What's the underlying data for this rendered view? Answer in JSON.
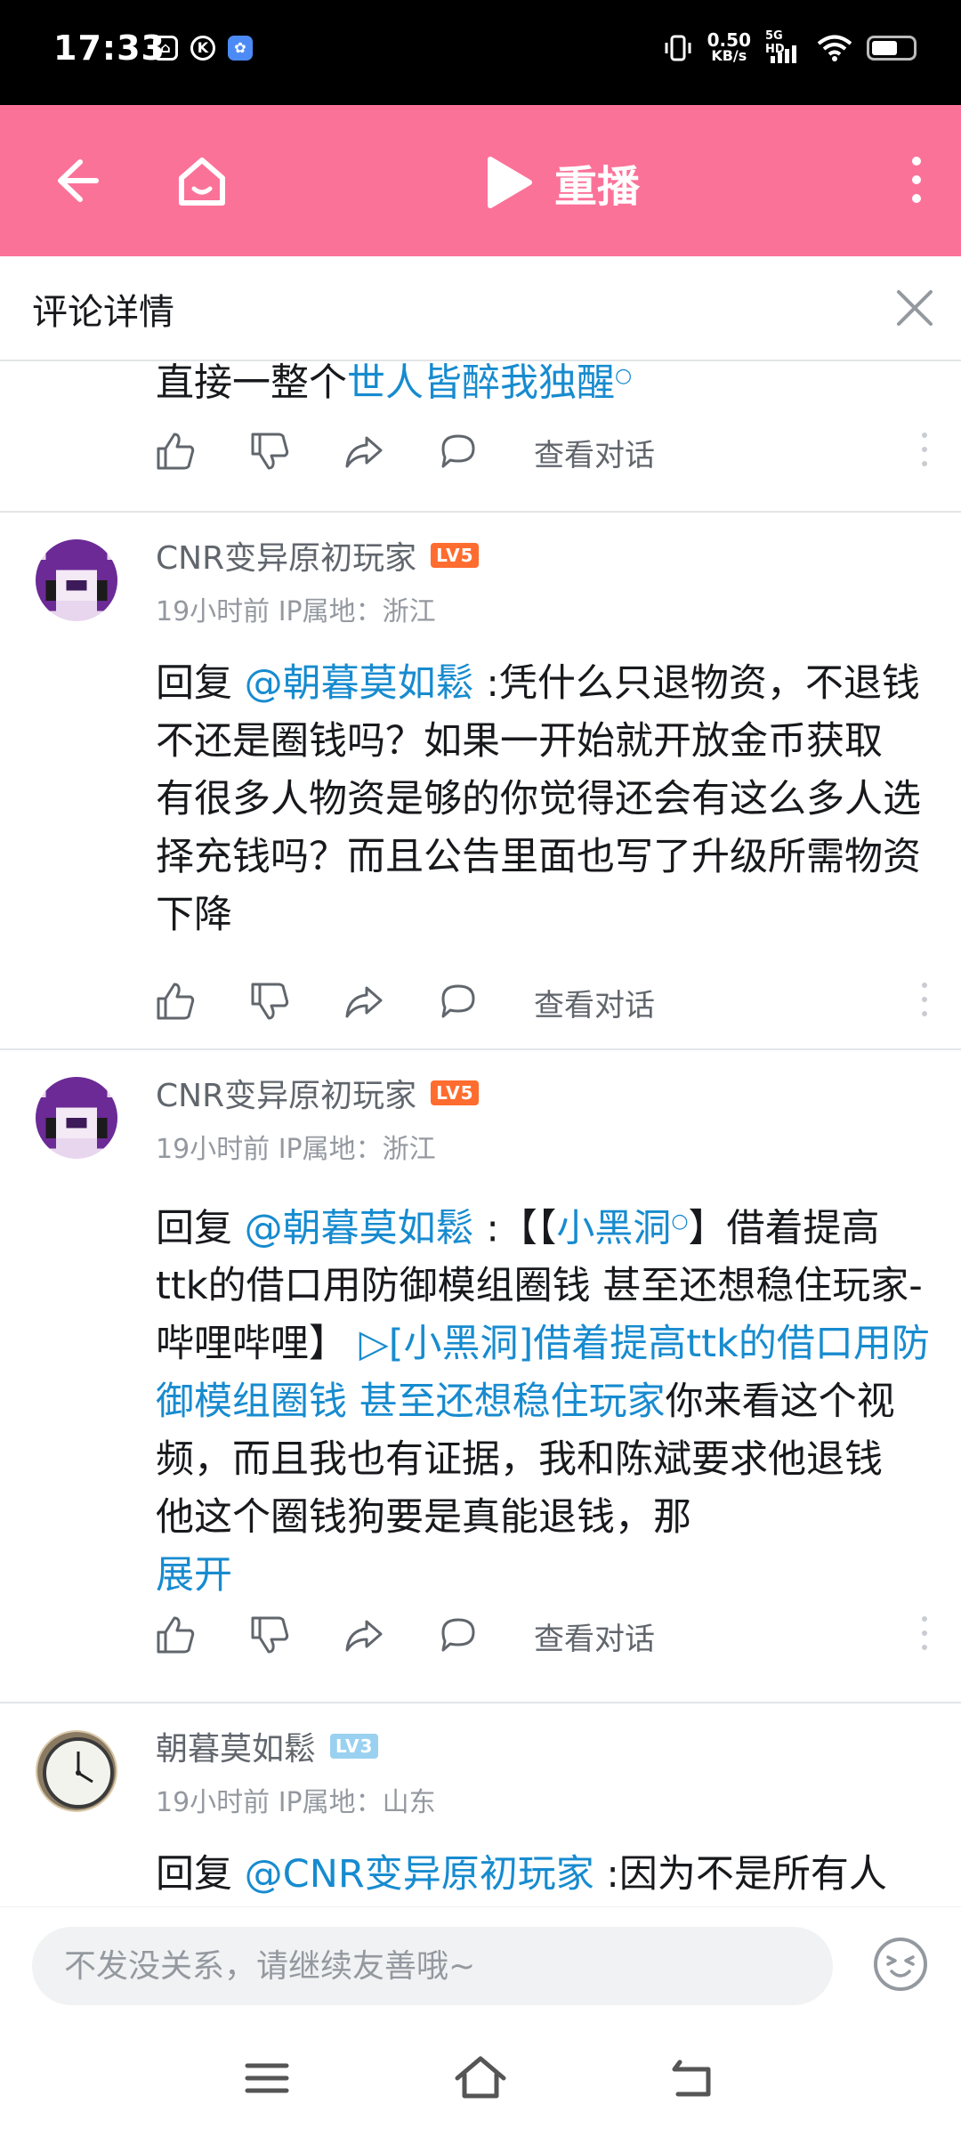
{
  "status_bar": {
    "time": "17:33",
    "net_speed_value": "0.50",
    "net_speed_unit": "KB/s",
    "network_type": "5G HD",
    "icons": [
      "tv-icon",
      "k-icon",
      "baidu-icon",
      "vibrate-icon",
      "signal-icon",
      "wifi-icon",
      "battery-icon"
    ]
  },
  "header": {
    "replay_label": "重播",
    "icons": [
      "back-arrow-icon",
      "home-icon",
      "play-icon",
      "more-vertical-icon"
    ],
    "background_color": "#fb7299"
  },
  "panel": {
    "title": "评论详情",
    "close_icon": "close-icon"
  },
  "comments": {
    "partial_top": {
      "text_prefix": "直接一整个",
      "link_text": "世人皆醉我独醒",
      "view_dialog": "查看对话"
    },
    "c1": {
      "username": "CNR变异原初玩家",
      "level": "LV5",
      "meta": "19小时前 IP属地：浙江",
      "reply_prefix": "回复 ",
      "mention": "@朝暮莫如鬆",
      "text": " :凭什么只退物资，不退钱不还是圈钱吗？如果一开始就开放金币获取 有很多人物资是够的你觉得还会有这么多人选择充钱吗？而且公告里面也写了升级所需物资下降",
      "view_dialog": "查看对话"
    },
    "c2": {
      "username": "CNR变异原初玩家",
      "level": "LV5",
      "meta": "19小时前 IP属地：浙江",
      "reply_prefix": "回复 ",
      "mention": "@朝暮莫如鬆",
      "text_a": " :【【",
      "search_link": "小黑洞",
      "text_b": "】借着提高ttk的借口用防御模组圈钱 甚至还想稳住玩家-哔哩哔哩】 ",
      "video_link": "[小黑洞]借着提高ttk的借口用防御模组圈钱 甚至还想稳住玩家",
      "text_c": "你来看这个视频，而且我也有证据，我和陈斌要求他退钱 他这个圈钱狗要是真能退钱，那",
      "expand": "展开",
      "view_dialog": "查看对话"
    },
    "c3": {
      "username": "朝暮莫如鬆",
      "level": "LV3",
      "meta": "19小时前 IP属地：山东",
      "reply_prefix": "回复 ",
      "mention": "@CNR变异原初玩家",
      "text": " :因为不是所有人"
    }
  },
  "input": {
    "placeholder": "不发没关系，请继续友善哦~",
    "emoji_icon": "emoji-icon"
  },
  "nav_bar": {
    "icons": [
      "menu-icon",
      "home-outline-icon",
      "back-icon"
    ]
  },
  "colors": {
    "accent": "#fb7299",
    "link": "#178bcf",
    "level5": "#ff6c2f",
    "level3": "#9ad1f0"
  }
}
